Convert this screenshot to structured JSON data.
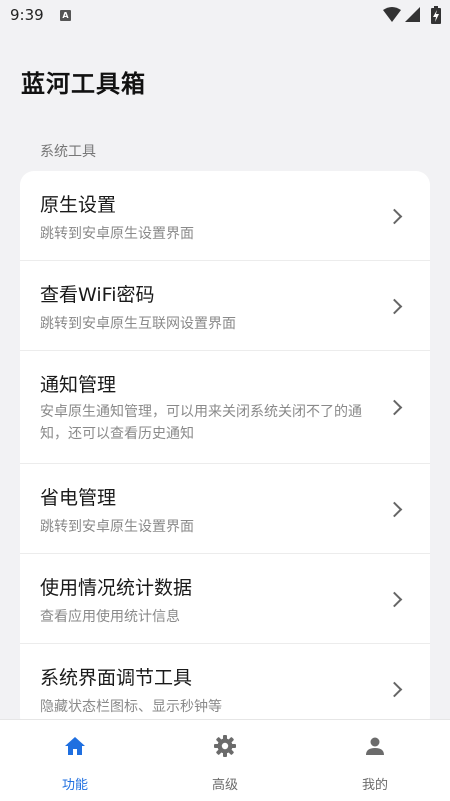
{
  "status_bar": {
    "time": "9:39",
    "notification_badge": "A",
    "icons": [
      "wifi-icon",
      "signal-icon",
      "battery-charging-icon"
    ]
  },
  "header": {
    "title": "蓝河工具箱"
  },
  "section": {
    "label": "系统工具"
  },
  "tools": [
    {
      "title": "原生设置",
      "desc": "跳转到安卓原生设置界面"
    },
    {
      "title": "查看WiFi密码",
      "desc": "跳转到安卓原生互联网设置界面"
    },
    {
      "title": "通知管理",
      "desc": "安卓原生通知管理，可以用来关闭系统关闭不了的通知，还可以查看历史通知"
    },
    {
      "title": "省电管理",
      "desc": "跳转到安卓原生设置界面"
    },
    {
      "title": "使用情况统计数据",
      "desc": "查看应用使用统计信息"
    },
    {
      "title": "系统界面调节工具",
      "desc": "隐藏状态栏图标、显示秒钟等"
    }
  ],
  "bottom_nav": {
    "items": [
      {
        "label": "功能",
        "icon": "home-icon",
        "active": true
      },
      {
        "label": "高级",
        "icon": "gear-icon",
        "active": false
      },
      {
        "label": "我的",
        "icon": "person-icon",
        "active": false
      }
    ]
  },
  "colors": {
    "accent": "#1f6fe0",
    "inactive": "#6b6b6b",
    "background": "#f2f2f4"
  }
}
